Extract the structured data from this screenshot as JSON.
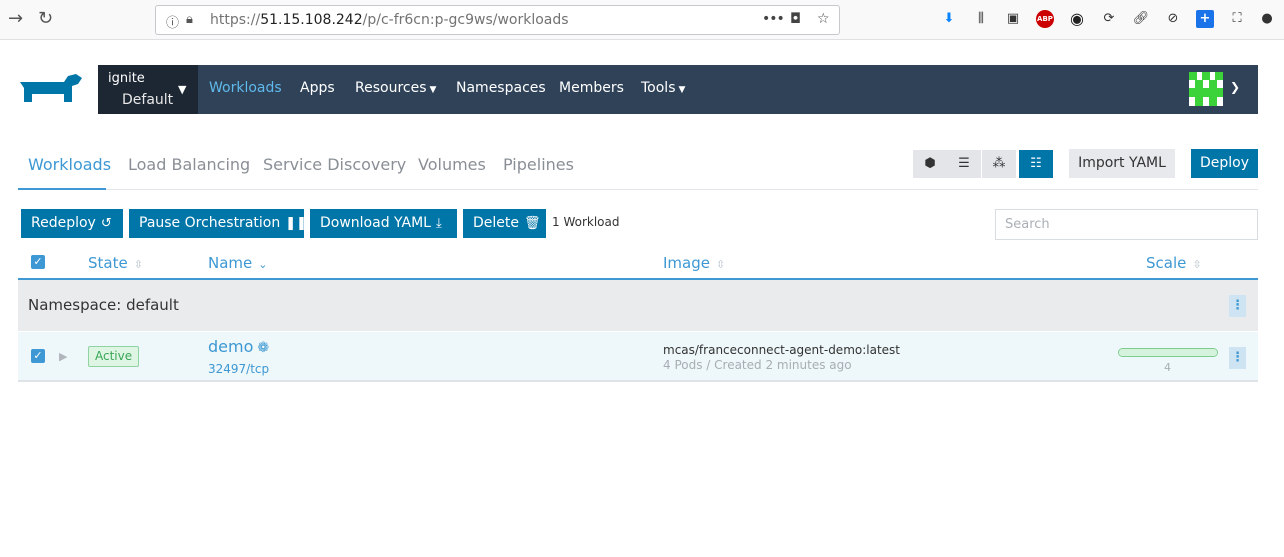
{
  "browser": {
    "url_prefix": "https://",
    "url_host": "51.15.108.242",
    "url_path": "/p/c-fr6cn:p-gc9ws/workloads",
    "menu_dots": "•••",
    "toolbar_icons": [
      "download-icon",
      "library-icon",
      "sidebar-icon",
      "adblock-icon",
      "extension-icon",
      "sync-icon",
      "link-icon",
      "blocker-icon",
      "plus-icon",
      "screenshot-icon",
      "account-icon"
    ],
    "adblock_label": "ABP"
  },
  "header": {
    "cluster_name": "ignite",
    "project_name": "Default",
    "nav": [
      {
        "label": "Workloads",
        "active": true,
        "dropdown": false
      },
      {
        "label": "Apps",
        "active": false,
        "dropdown": false
      },
      {
        "label": "Resources",
        "active": false,
        "dropdown": true
      },
      {
        "label": "Namespaces",
        "active": false,
        "dropdown": false
      },
      {
        "label": "Members",
        "active": false,
        "dropdown": false
      },
      {
        "label": "Tools",
        "active": false,
        "dropdown": true
      }
    ]
  },
  "subtabs": [
    {
      "label": "Workloads",
      "active": true
    },
    {
      "label": "Load Balancing",
      "active": false
    },
    {
      "label": "Service Discovery",
      "active": false
    },
    {
      "label": "Volumes",
      "active": false
    },
    {
      "label": "Pipelines",
      "active": false
    }
  ],
  "view_toggles": [
    {
      "icon": "node-icon",
      "active": false
    },
    {
      "icon": "list-icon",
      "active": false
    },
    {
      "icon": "group-icon",
      "active": false
    },
    {
      "icon": "tree-list-icon",
      "active": true
    }
  ],
  "import_label": "Import YAML",
  "deploy_label": "Deploy",
  "actions": {
    "redeploy": "Redeploy",
    "pause": "Pause Orchestration",
    "download": "Download YAML",
    "delete": "Delete"
  },
  "workload_count": "1 Workload",
  "search_placeholder": "Search",
  "table": {
    "columns": {
      "state": "State",
      "name": "Name",
      "image": "Image",
      "scale": "Scale"
    },
    "namespace_label": "Namespace: default",
    "rows": [
      {
        "state": "Active",
        "name": "demo",
        "port": "32497/tcp",
        "image": "mcas/franceconnect-agent-demo:latest",
        "detail": "4 Pods / Created 2 minutes ago",
        "scale": "4",
        "scale_fraction": 1.0
      }
    ]
  },
  "colors": {
    "primary": "#0075a8",
    "accent": "#3d98d3",
    "header_bg": "#2f4258",
    "active_green": "#3aa757"
  }
}
